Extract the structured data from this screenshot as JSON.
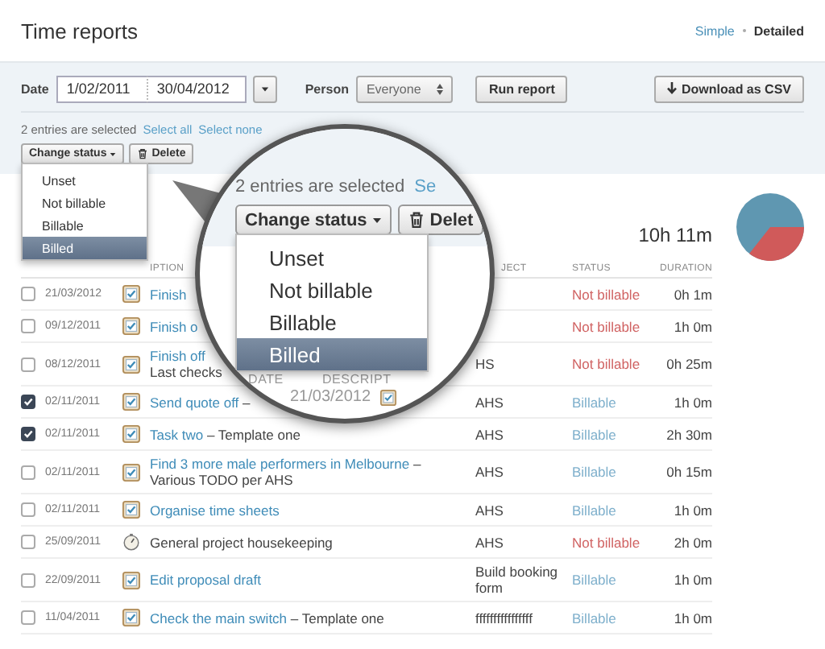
{
  "page": {
    "title": "Time reports",
    "views": [
      {
        "label": "Simple",
        "selected": false
      },
      {
        "label": "Detailed",
        "selected": true
      }
    ]
  },
  "filters": {
    "date_label": "Date",
    "date_from": "1/02/2011",
    "date_to": "30/04/2012",
    "person_label": "Person",
    "person": "Everyone",
    "run_button": "Run report",
    "download_button": "Download as CSV"
  },
  "selection": {
    "summary": "2 entries are selected",
    "select_all": "Select all",
    "select_none": "Select none",
    "change_status": "Change status",
    "delete": "Delete"
  },
  "status_menu": [
    {
      "label": "Unset",
      "selected": false
    },
    {
      "label": "Not billable",
      "selected": false
    },
    {
      "label": "Billable",
      "selected": false
    },
    {
      "label": "Billed",
      "selected": true
    }
  ],
  "magnifier": {
    "summary": "2 entries are selected",
    "link": "Se",
    "change_status": "Change status",
    "delete": "Delet",
    "menu": [
      {
        "label": "Unset",
        "selected": false
      },
      {
        "label": "Not billable",
        "selected": false
      },
      {
        "label": "Billable",
        "selected": false
      },
      {
        "label": "Billed",
        "selected": true
      }
    ],
    "columns": [
      "DATE",
      "DESCRIPT"
    ],
    "date": "21/03/2012"
  },
  "total": "10h 11m",
  "table": {
    "columns": [
      {
        "kind": "description",
        "label": "IPTION"
      },
      {
        "kind": "project",
        "label": "JECT"
      },
      {
        "kind": "status",
        "label": "STATUS"
      },
      {
        "kind": "duration",
        "label": "DURATION"
      }
    ],
    "rows": [
      {
        "checked": false,
        "date": "21/03/2012",
        "kind": "task",
        "title": "Finish",
        "status": "Not billable",
        "billable": false,
        "duration": "0h 1m"
      },
      {
        "checked": false,
        "date": "09/12/2011",
        "kind": "task",
        "title": "Finish o",
        "status": "Not billable",
        "billable": false,
        "duration": "1h 0m"
      },
      {
        "checked": false,
        "date": "08/12/2011",
        "kind": "task",
        "title": "Finish off",
        "detail": "Last checks",
        "project": "HS",
        "status": "Not billable",
        "billable": false,
        "duration": "0h 25m"
      },
      {
        "checked": true,
        "date": "02/11/2011",
        "kind": "task",
        "title": "Send quote off",
        "note": "–",
        "project": "AHS",
        "status": "Billable",
        "billable": true,
        "duration": "1h 0m"
      },
      {
        "checked": true,
        "date": "02/11/2011",
        "kind": "task",
        "title": "Task two",
        "note": "– Template one",
        "project": "AHS",
        "status": "Billable",
        "billable": true,
        "duration": "2h 30m"
      },
      {
        "checked": false,
        "date": "02/11/2011",
        "kind": "task",
        "title": "Find 3 more male performers in Melbourne",
        "note": "– Various TODO per AHS",
        "project": "AHS",
        "status": "Billable",
        "billable": true,
        "duration": "0h 15m"
      },
      {
        "checked": false,
        "date": "02/11/2011",
        "kind": "task",
        "title": "Organise time sheets",
        "project": "AHS",
        "status": "Billable",
        "billable": true,
        "duration": "1h 0m"
      },
      {
        "checked": false,
        "date": "25/09/2011",
        "kind": "timer",
        "title": "General project housekeeping",
        "project": "AHS",
        "status": "Not billable",
        "billable": false,
        "duration": "2h 0m"
      },
      {
        "checked": false,
        "date": "22/09/2011",
        "kind": "task",
        "title": "Edit proposal draft",
        "project": "Build booking form",
        "status": "Billable",
        "billable": true,
        "duration": "1h 0m"
      },
      {
        "checked": false,
        "date": "11/04/2011",
        "kind": "task",
        "title": "Check the main switch",
        "note": "– Template one",
        "project": "ffffffffffffffff",
        "status": "Billable",
        "billable": true,
        "duration": "1h 0m"
      }
    ]
  }
}
